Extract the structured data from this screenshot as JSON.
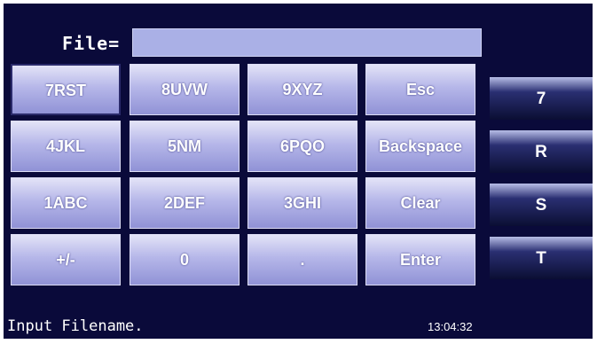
{
  "file_field": {
    "label": "File=",
    "value": ""
  },
  "keypad": {
    "rows": [
      [
        "7RST",
        "8UVW",
        "9XYZ",
        "Esc"
      ],
      [
        "4JKL",
        "5NM",
        "6PQO",
        "Backspace"
      ],
      [
        "1ABC",
        "2DEF",
        "3GHI",
        "Clear"
      ],
      [
        "+/-",
        "0",
        ".",
        "Enter"
      ]
    ],
    "selected_key": "7RST"
  },
  "char_options": [
    "7",
    "R",
    "S",
    "T"
  ],
  "status": {
    "message": "Input Filename.",
    "time": "13:04:32"
  },
  "colors": {
    "screen_bg": "#0a0a3a",
    "key_face": "#b6b7e9",
    "input_bg": "#aab0e6"
  }
}
